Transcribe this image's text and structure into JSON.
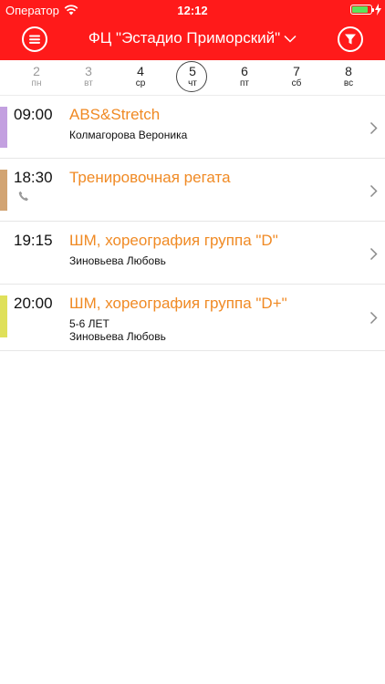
{
  "status": {
    "carrier": "Оператор",
    "time": "12:12",
    "battery_level": 0.85
  },
  "header": {
    "title": "ФЦ \"Эстадио Приморский\"",
    "menu_icon": "menu-icon",
    "filter_icon": "filter-icon",
    "dropdown_icon": "chevron-down-icon",
    "background": "#ff1a1a"
  },
  "days": [
    {
      "num": "2",
      "dow": "пн"
    },
    {
      "num": "3",
      "dow": "вт"
    },
    {
      "num": "4",
      "dow": "ср"
    },
    {
      "num": "5",
      "dow": "чт"
    },
    {
      "num": "6",
      "dow": "пт"
    },
    {
      "num": "7",
      "dow": "сб"
    },
    {
      "num": "8",
      "dow": "вс"
    }
  ],
  "selected_day": "5",
  "classes": [
    {
      "time": "09:00",
      "title": "ABS&Stretch",
      "trainer": "Колмагорова Вероника",
      "color": "#c3a0e0"
    },
    {
      "time": "18:30",
      "title": "Тренировочная регата",
      "color": "#d2a473",
      "icon": "phone-icon"
    },
    {
      "time": "19:15",
      "title": "ШМ, хореография группа \"D\"",
      "trainer": "Зиновьева Любовь"
    },
    {
      "time": "20:00",
      "title": "ШМ, хореография группа \"D+\"",
      "age": "5-6 ЛЕТ",
      "trainer": "Зиновьева Любовь",
      "color": "#dfe05a"
    }
  ],
  "accent_title_color": "#f08a24"
}
